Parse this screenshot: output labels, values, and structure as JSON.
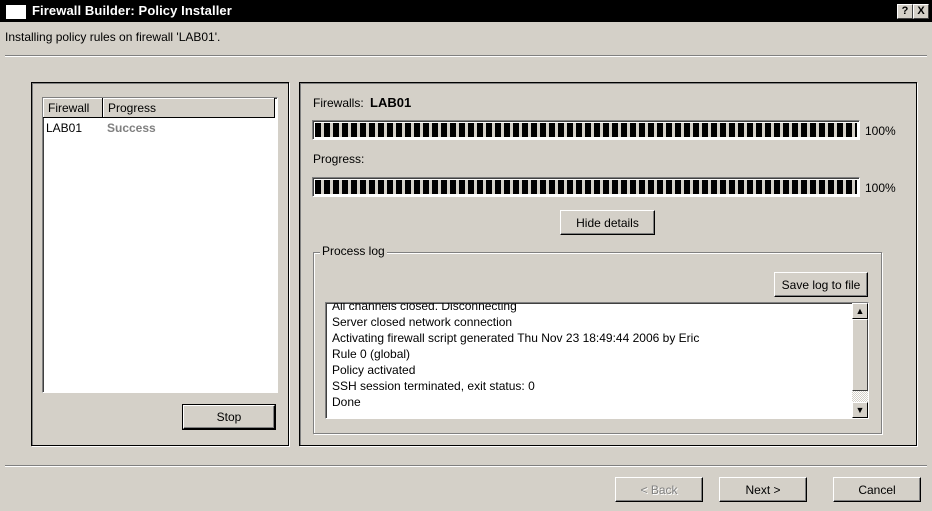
{
  "window": {
    "title": "Firewall Builder: Policy Installer",
    "help_btn": "?",
    "close_btn": "X"
  },
  "subtitle": "Installing policy rules on firewall 'LAB01'.",
  "fw_list": {
    "columns": [
      "Firewall",
      "Progress"
    ],
    "rows": [
      {
        "firewall": "LAB01",
        "progress": "Success"
      }
    ]
  },
  "stop_label": "Stop",
  "firewalls_label": "Firewalls:",
  "firewall_name": "LAB01",
  "bar1": {
    "value": 1.0,
    "pct": "100%"
  },
  "progress_label": "Progress:",
  "bar2": {
    "value": 1.0,
    "pct": "100%"
  },
  "hide_details_label": "Hide details",
  "process_log": {
    "title": "Process log",
    "save_label": "Save log to file",
    "lines": [
      "All channels closed. Disconnecting",
      "Server closed network connection",
      "Activating firewall script generated Thu Nov 23 18:49:44 2006 by Eric",
      "Rule 0 (global)",
      "Policy activated",
      "SSH session terminated, exit status: 0",
      "Done"
    ]
  },
  "nav": {
    "back": "< Back",
    "next": "Next >",
    "cancel": "Cancel"
  },
  "colors": {
    "success_text": "#808080",
    "window_bg": "#d4d0c8"
  }
}
